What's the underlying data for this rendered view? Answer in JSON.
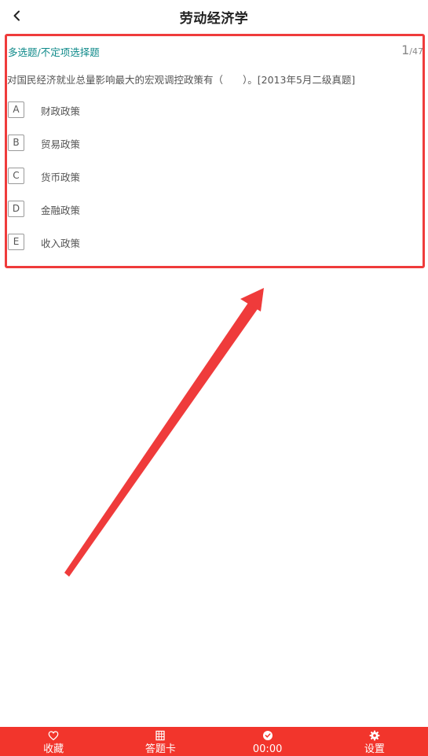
{
  "header": {
    "title": "劳动经济学",
    "back_icon": "chevron-left-icon"
  },
  "question": {
    "type_label": "多选题/不定项选择题",
    "current": "1",
    "total": "/47",
    "stem": "对国民经济就业总量影响最大的宏观调控政策有（　　）。[2013年5月二级真题]",
    "options": [
      {
        "letter": "A",
        "text": "财政政策"
      },
      {
        "letter": "B",
        "text": "贸易政策"
      },
      {
        "letter": "C",
        "text": "货币政策"
      },
      {
        "letter": "D",
        "text": "金融政策"
      },
      {
        "letter": "E",
        "text": "收入政策"
      }
    ]
  },
  "bottom_bar": {
    "items": [
      {
        "label": "收藏",
        "icon": "heart-icon"
      },
      {
        "label": "答题卡",
        "icon": "grid-card-icon"
      },
      {
        "label": "00:00",
        "icon": "clock-icon"
      },
      {
        "label": "设置",
        "icon": "gear-icon"
      }
    ]
  },
  "colors": {
    "accent_red": "#f2352c",
    "highlight_red": "#ef3b3b",
    "type_teal": "#0f8a8a"
  }
}
